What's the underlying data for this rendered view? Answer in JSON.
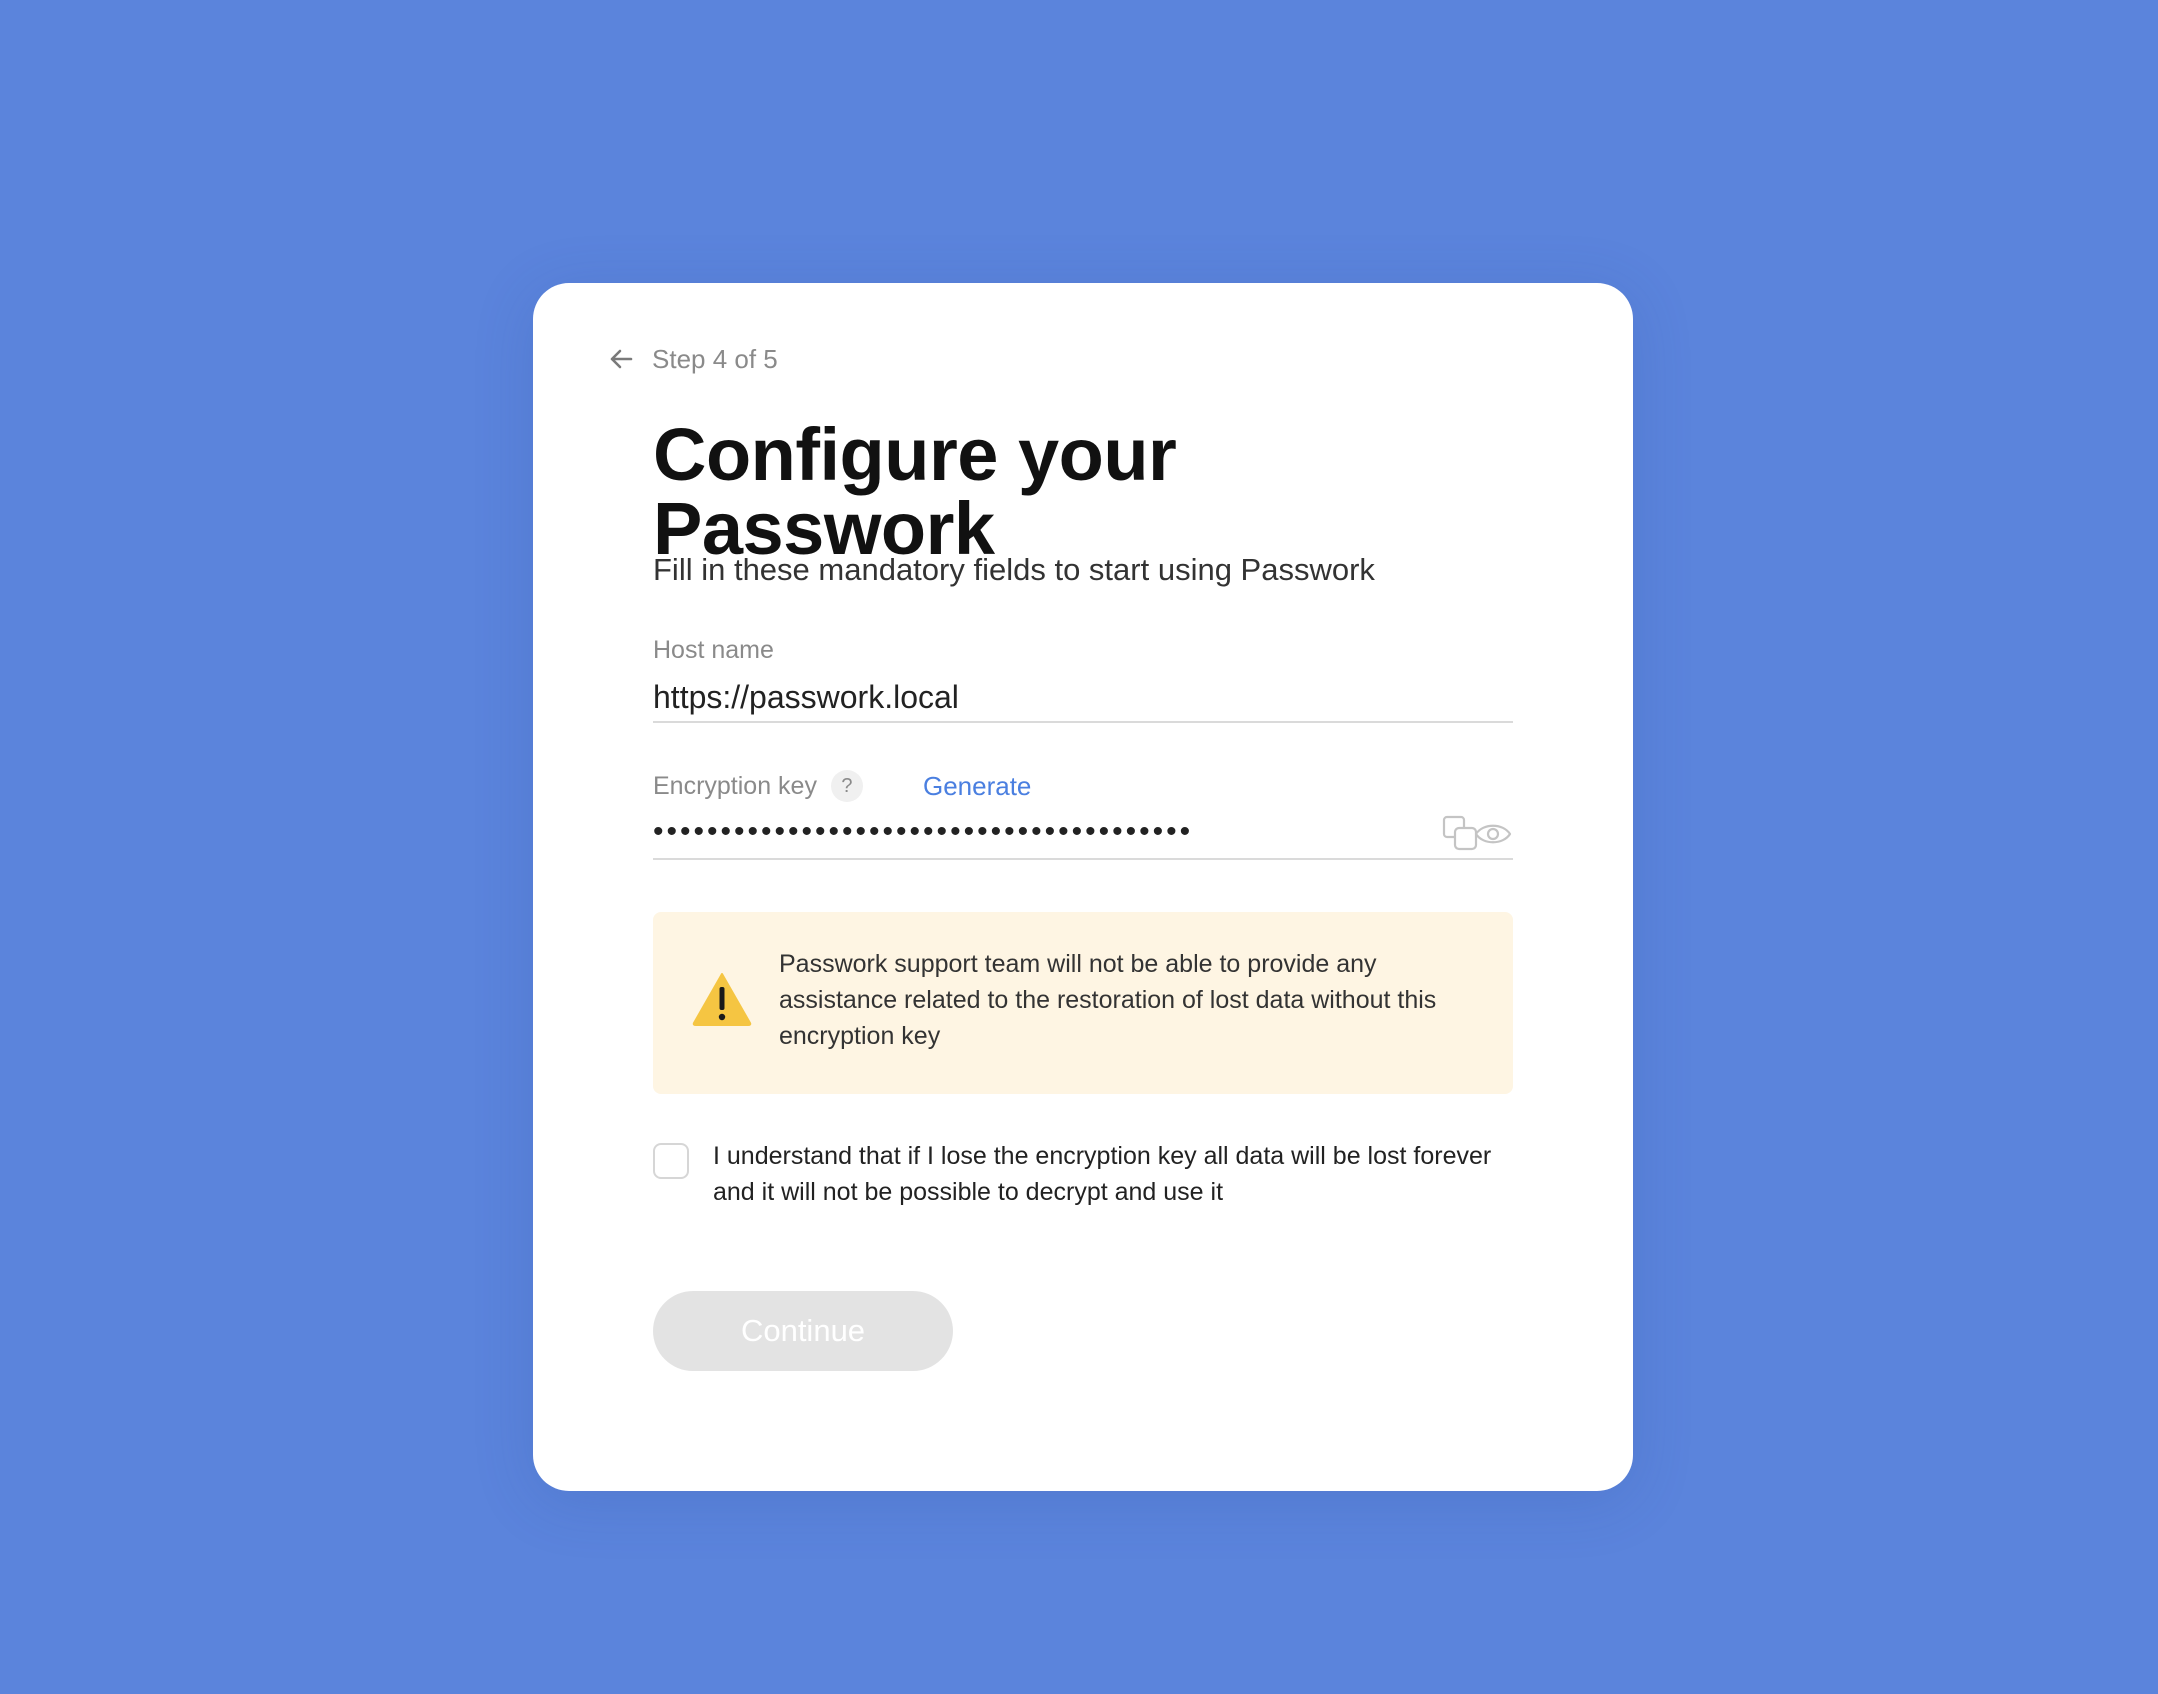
{
  "header": {
    "step_text": "Step 4 of 5"
  },
  "main": {
    "title": "Configure your Passwork",
    "subtitle": "Fill in these mandatory fields to start using Passwork"
  },
  "host_field": {
    "label": "Host name",
    "value": "https://passwork.local"
  },
  "encryption_field": {
    "label": "Encryption key",
    "help_glyph": "?",
    "generate_label": "Generate",
    "masked_value": "••••••••••••••••••••••••••••••••••••••••",
    "icons": [
      "copy-icon",
      "eye-icon"
    ]
  },
  "warning": {
    "text": "Passwork support team will not be able to provide any assistance related to the restoration of lost data without this encryption key",
    "icon": "warning-icon"
  },
  "acknowledge": {
    "checked": false,
    "label": "I understand that if I lose the encryption key all data will be lost forever and it will not be possible to decrypt and use it"
  },
  "actions": {
    "continue_label": "Continue"
  },
  "colors": {
    "background": "#5b84dc",
    "card": "#ffffff",
    "link": "#4a7fe0",
    "warning_bg": "#fef5e3",
    "warning_icon": "#f5c542",
    "button_disabled": "#e3e3e3"
  }
}
